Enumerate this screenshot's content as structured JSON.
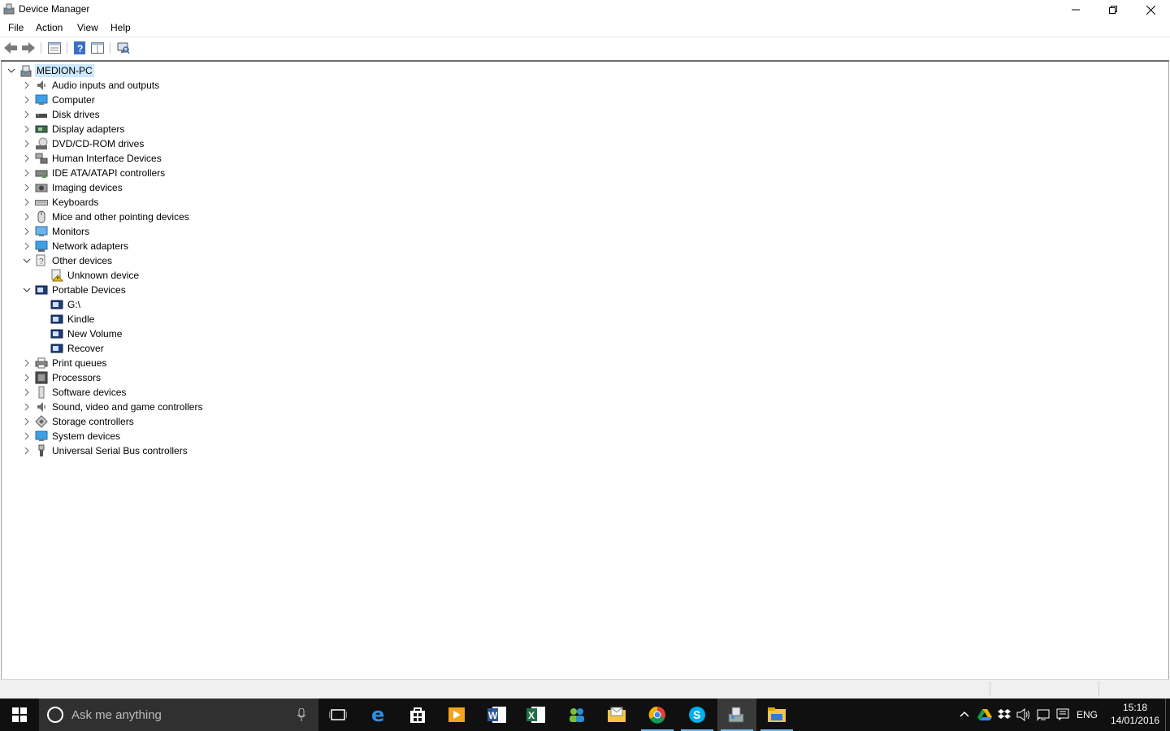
{
  "window": {
    "title": "Device Manager",
    "app_icon": "device-manager-icon"
  },
  "menu": [
    "File",
    "Action",
    "View",
    "Help"
  ],
  "toolbar": {
    "buttons": [
      "back-arrow-icon",
      "forward-arrow-icon",
      "properties-sheet-icon",
      "help-icon",
      "details-pane-icon",
      "scan-hardware-icon"
    ]
  },
  "tree": {
    "root": {
      "label": "MEDION-PC",
      "icon": "computer-icon",
      "expanded": true,
      "selected": true
    },
    "items": [
      {
        "label": "Audio inputs and outputs",
        "icon": "speaker-icon",
        "expanded": false
      },
      {
        "label": "Computer",
        "icon": "monitor-icon",
        "expanded": false
      },
      {
        "label": "Disk drives",
        "icon": "disk-drive-icon",
        "expanded": false
      },
      {
        "label": "Display adapters",
        "icon": "display-adapter-icon",
        "expanded": false
      },
      {
        "label": "DVD/CD-ROM drives",
        "icon": "dvd-drive-icon",
        "expanded": false
      },
      {
        "label": "Human Interface Devices",
        "icon": "hid-icon",
        "expanded": false
      },
      {
        "label": "IDE ATA/ATAPI controllers",
        "icon": "ide-controller-icon",
        "expanded": false
      },
      {
        "label": "Imaging devices",
        "icon": "camera-icon",
        "expanded": false
      },
      {
        "label": "Keyboards",
        "icon": "keyboard-icon",
        "expanded": false
      },
      {
        "label": "Mice and other pointing devices",
        "icon": "mouse-icon",
        "expanded": false
      },
      {
        "label": "Monitors",
        "icon": "monitor-icon",
        "expanded": false
      },
      {
        "label": "Network adapters",
        "icon": "network-adapter-icon",
        "expanded": false
      },
      {
        "label": "Other devices",
        "icon": "unknown-device-icon",
        "expanded": true,
        "children": [
          {
            "label": "Unknown device",
            "icon": "warning-device-icon"
          }
        ]
      },
      {
        "label": "Portable Devices",
        "icon": "portable-device-icon",
        "expanded": true,
        "children": [
          {
            "label": "G:\\",
            "icon": "portable-device-icon"
          },
          {
            "label": "Kindle",
            "icon": "portable-device-icon"
          },
          {
            "label": "New Volume",
            "icon": "portable-device-icon"
          },
          {
            "label": "Recover",
            "icon": "portable-device-icon"
          }
        ]
      },
      {
        "label": "Print queues",
        "icon": "printer-icon",
        "expanded": false
      },
      {
        "label": "Processors",
        "icon": "processor-icon",
        "expanded": false
      },
      {
        "label": "Software devices",
        "icon": "software-device-icon",
        "expanded": false
      },
      {
        "label": "Sound, video and game controllers",
        "icon": "speaker-icon",
        "expanded": false
      },
      {
        "label": "Storage controllers",
        "icon": "storage-controller-icon",
        "expanded": false
      },
      {
        "label": "System devices",
        "icon": "monitor-icon",
        "expanded": false
      },
      {
        "label": "Universal Serial Bus controllers",
        "icon": "usb-icon",
        "expanded": false
      }
    ]
  },
  "taskbar": {
    "search_placeholder": "Ask me anything",
    "apps": [
      "task-view-icon",
      "edge-icon",
      "store-icon",
      "media-player-icon",
      "word-icon",
      "excel-icon",
      "people-icon",
      "mail-folder-icon",
      "chrome-icon",
      "skype-icon",
      "device-manager-icon",
      "file-explorer-icon"
    ],
    "tray": {
      "language": "ENG",
      "time": "15:18",
      "date": "14/01/2016"
    }
  },
  "colors": {
    "selection": "#cce8ff",
    "taskbar_bg": "#101010",
    "search_bg": "#303030",
    "accent": "#76b9ed"
  }
}
